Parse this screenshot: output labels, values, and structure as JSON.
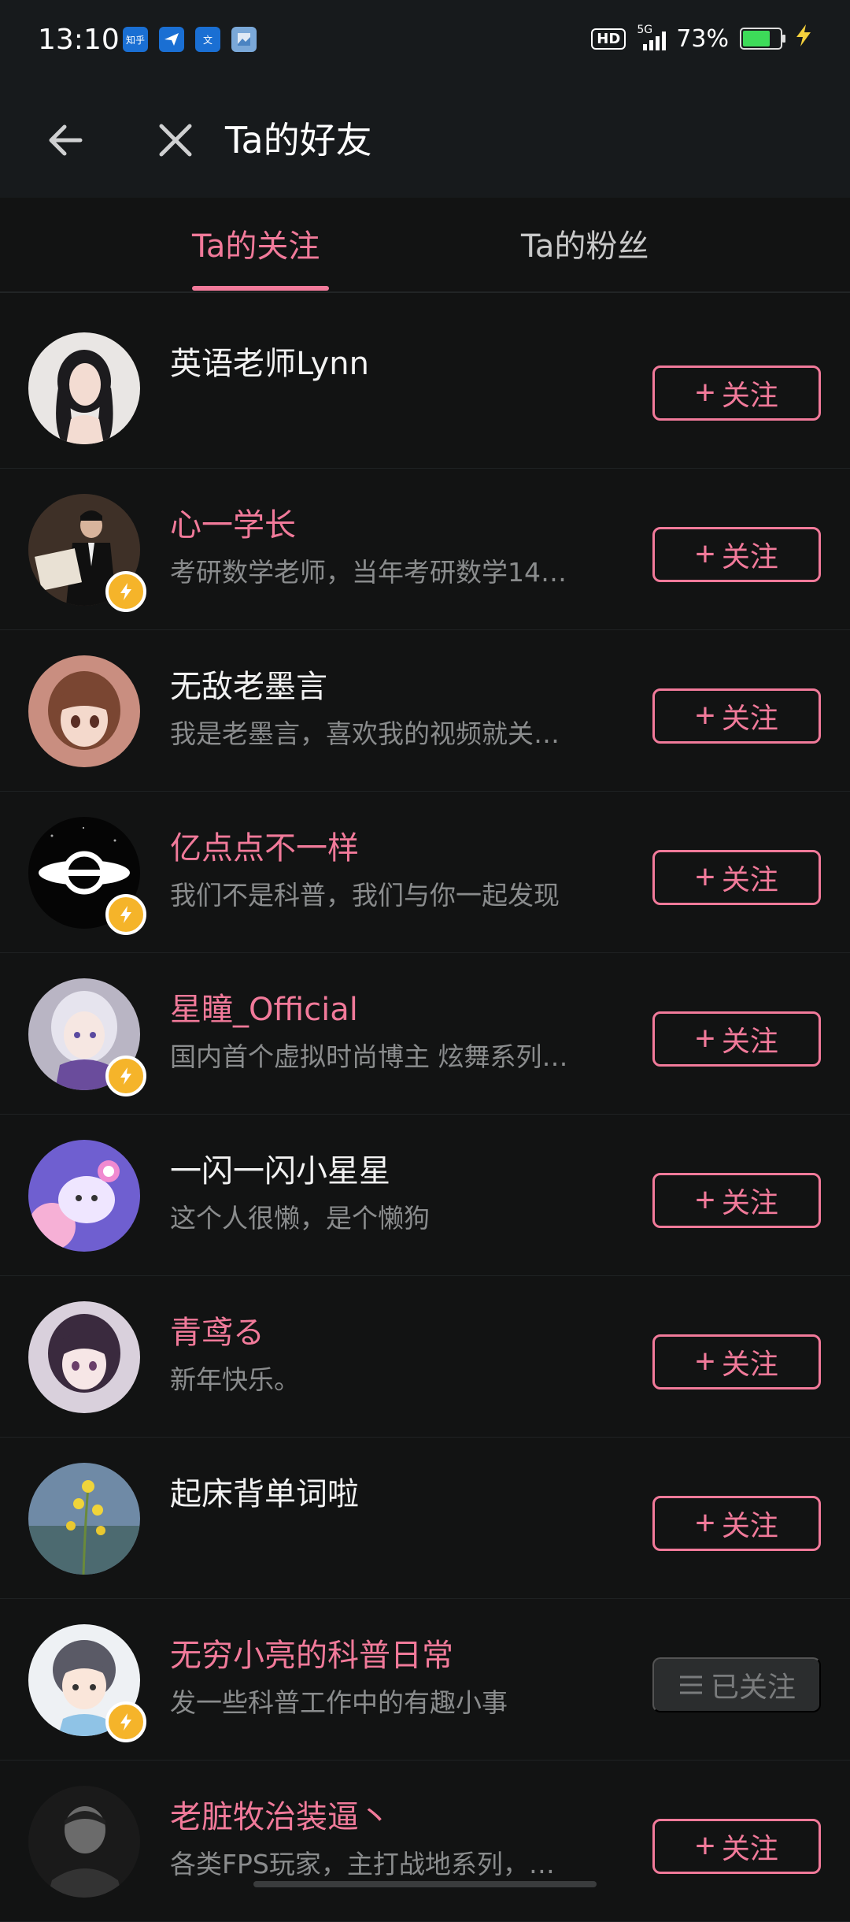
{
  "status_bar": {
    "time": "13:10",
    "app_icons": [
      "知乎",
      "飞书",
      "文",
      "图"
    ],
    "hd": "HD",
    "network": "5G",
    "battery_percent": "73%",
    "battery_level": 0.73,
    "battery_color": "#3ddb59"
  },
  "header": {
    "title": "Ta的好友"
  },
  "tabs": [
    {
      "label": "Ta的关注",
      "active": true
    },
    {
      "label": "Ta的粉丝",
      "active": false
    }
  ],
  "colors": {
    "accent": "#f17a9a",
    "background": "#121313",
    "verified": "#f5b42a"
  },
  "users": [
    {
      "name": "英语老师Lynn",
      "desc": "",
      "highlight": false,
      "verified": false,
      "button": "关注",
      "followed": false,
      "avatar": "portrait-girl-black-hair"
    },
    {
      "name": "心一学长",
      "desc": "考研数学老师，当年考研数学14…",
      "highlight": true,
      "verified": true,
      "button": "关注",
      "followed": false,
      "avatar": "man-with-book"
    },
    {
      "name": "无敌老墨言",
      "desc": "我是老墨言，喜欢我的视频就关…",
      "highlight": false,
      "verified": false,
      "button": "关注",
      "followed": false,
      "avatar": "anime-girl-brown-hair"
    },
    {
      "name": "亿点点不一样",
      "desc": "我们不是科普，我们与你一起发现",
      "highlight": true,
      "verified": true,
      "button": "关注",
      "followed": false,
      "avatar": "black-hole-logo"
    },
    {
      "name": "星瞳_Official",
      "desc": "国内首个虚拟时尚博主 炫舞系列…",
      "highlight": true,
      "verified": true,
      "button": "关注",
      "followed": false,
      "avatar": "virtual-girl-silver-hair"
    },
    {
      "name": "一闪一闪小星星",
      "desc": "这个人很懒，是个懒狗",
      "highlight": false,
      "verified": false,
      "button": "关注",
      "followed": false,
      "avatar": "cute-creature"
    },
    {
      "name": "青鸢る",
      "desc": "新年快乐。",
      "highlight": true,
      "verified": false,
      "button": "关注",
      "followed": false,
      "avatar": "anime-girl-purple-hair"
    },
    {
      "name": "起床背单词啦",
      "desc": "",
      "highlight": false,
      "verified": false,
      "button": "关注",
      "followed": false,
      "avatar": "yellow-flowers"
    },
    {
      "name": "无穷小亮的科普日常",
      "desc": "发一些科普工作中的有趣小事",
      "highlight": true,
      "verified": true,
      "button": "已关注",
      "followed": true,
      "avatar": "cartoon-boy"
    },
    {
      "name": "老脏牧治装逼丶",
      "desc": "各类FPS玩家，主打战地系列，…",
      "highlight": true,
      "verified": false,
      "button": "关注",
      "followed": false,
      "avatar": "dark-portrait-man"
    }
  ]
}
